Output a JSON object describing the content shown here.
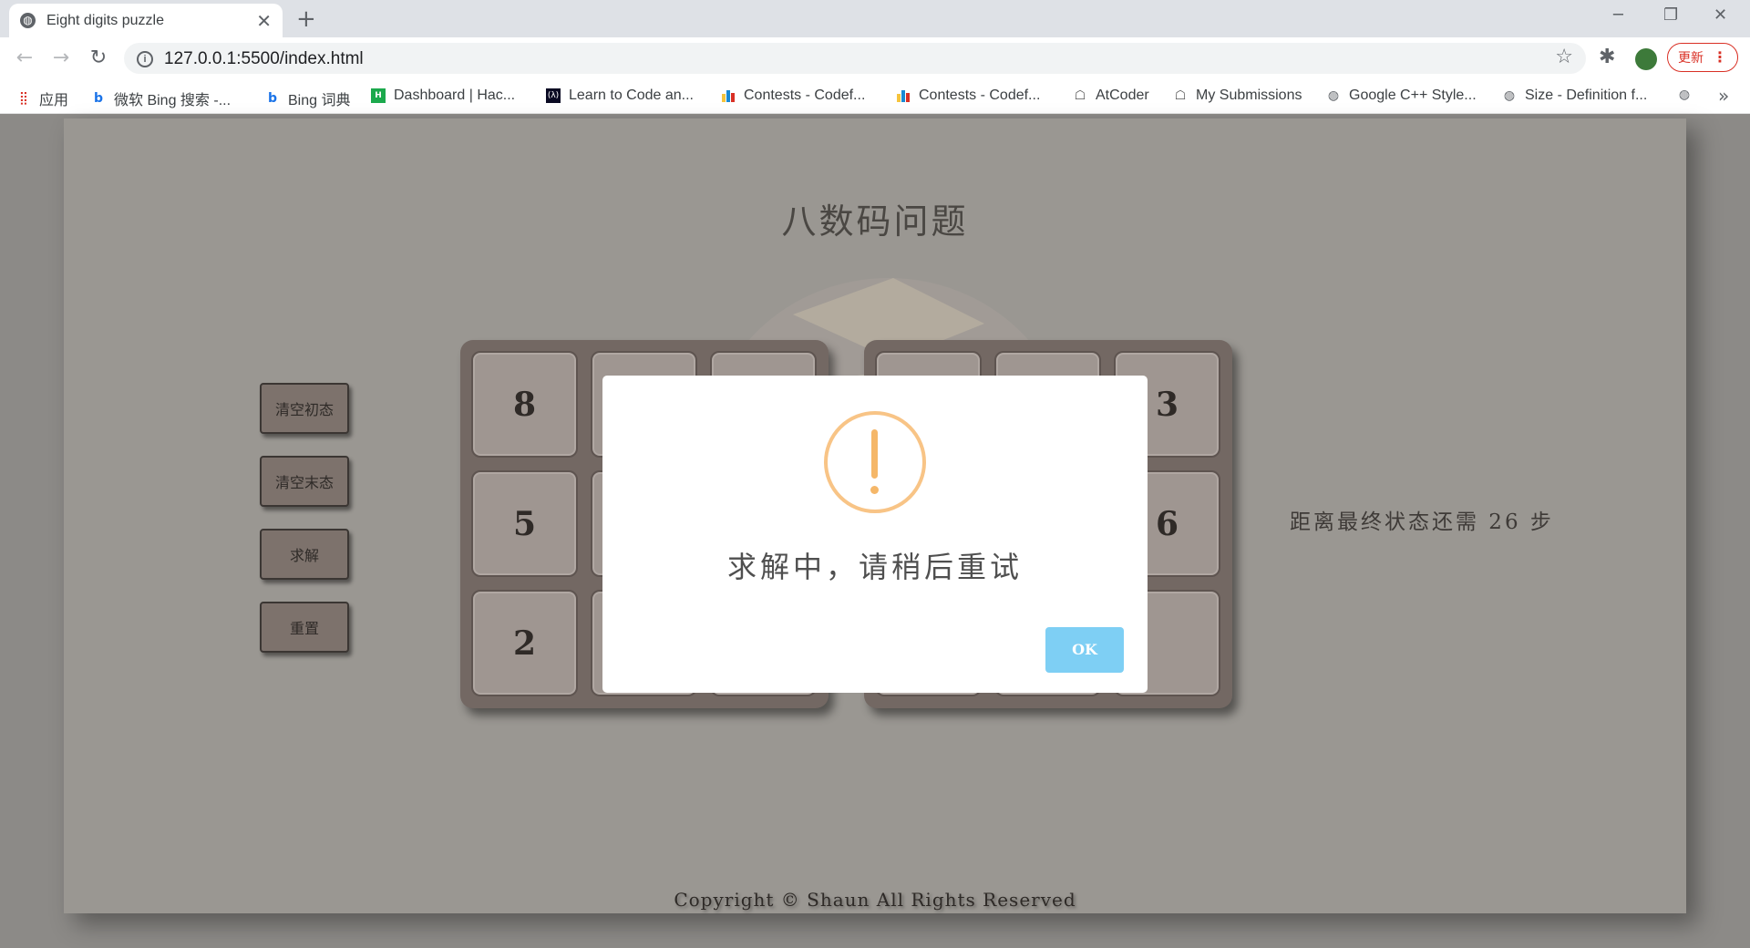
{
  "browser": {
    "tab_title": "Eight digits puzzle",
    "url": "127.0.0.1:5500/index.html",
    "update_label": "更新",
    "bookmarks": [
      {
        "label": "应用",
        "icon": "apps-grid-icon"
      },
      {
        "label": "微软 Bing 搜索 -...",
        "icon": "bing-icon"
      },
      {
        "label": "Bing 词典",
        "icon": "bing-icon"
      },
      {
        "label": "Dashboard | Hac...",
        "icon": "hackerrank-icon"
      },
      {
        "label": "Learn to Code an...",
        "icon": "freecodecamp-icon"
      },
      {
        "label": "Contests - Codef...",
        "icon": "codeforces-icon"
      },
      {
        "label": "Contests - Codef...",
        "icon": "codeforces-icon"
      },
      {
        "label": "AtCoder",
        "icon": "atcoder-icon"
      },
      {
        "label": "My Submissions",
        "icon": "atcoder-icon"
      },
      {
        "label": "Google C++ Style...",
        "icon": "globe-icon"
      },
      {
        "label": "Size - Definition f...",
        "icon": "globe-icon"
      }
    ]
  },
  "page": {
    "title": "八数码问题",
    "buttons": {
      "clear_initial": "清空初态",
      "clear_final": "清空末态",
      "solve": "求解",
      "reset": "重置"
    },
    "initial_board": [
      "8",
      "",
      "",
      "5",
      "",
      "",
      "2",
      "",
      ""
    ],
    "final_board": [
      "",
      "",
      "3",
      "",
      "",
      "6",
      "",
      "",
      ""
    ],
    "steps_text": "距离最终状态还需 26 步",
    "copyright": "Copyright © Shaun All Rights Reserved"
  },
  "modal": {
    "icon": "warning-icon",
    "icon_color": "#f8c486",
    "message": "求解中，请稍后重试",
    "ok_label": "OK",
    "ok_color": "#7ecff4"
  }
}
